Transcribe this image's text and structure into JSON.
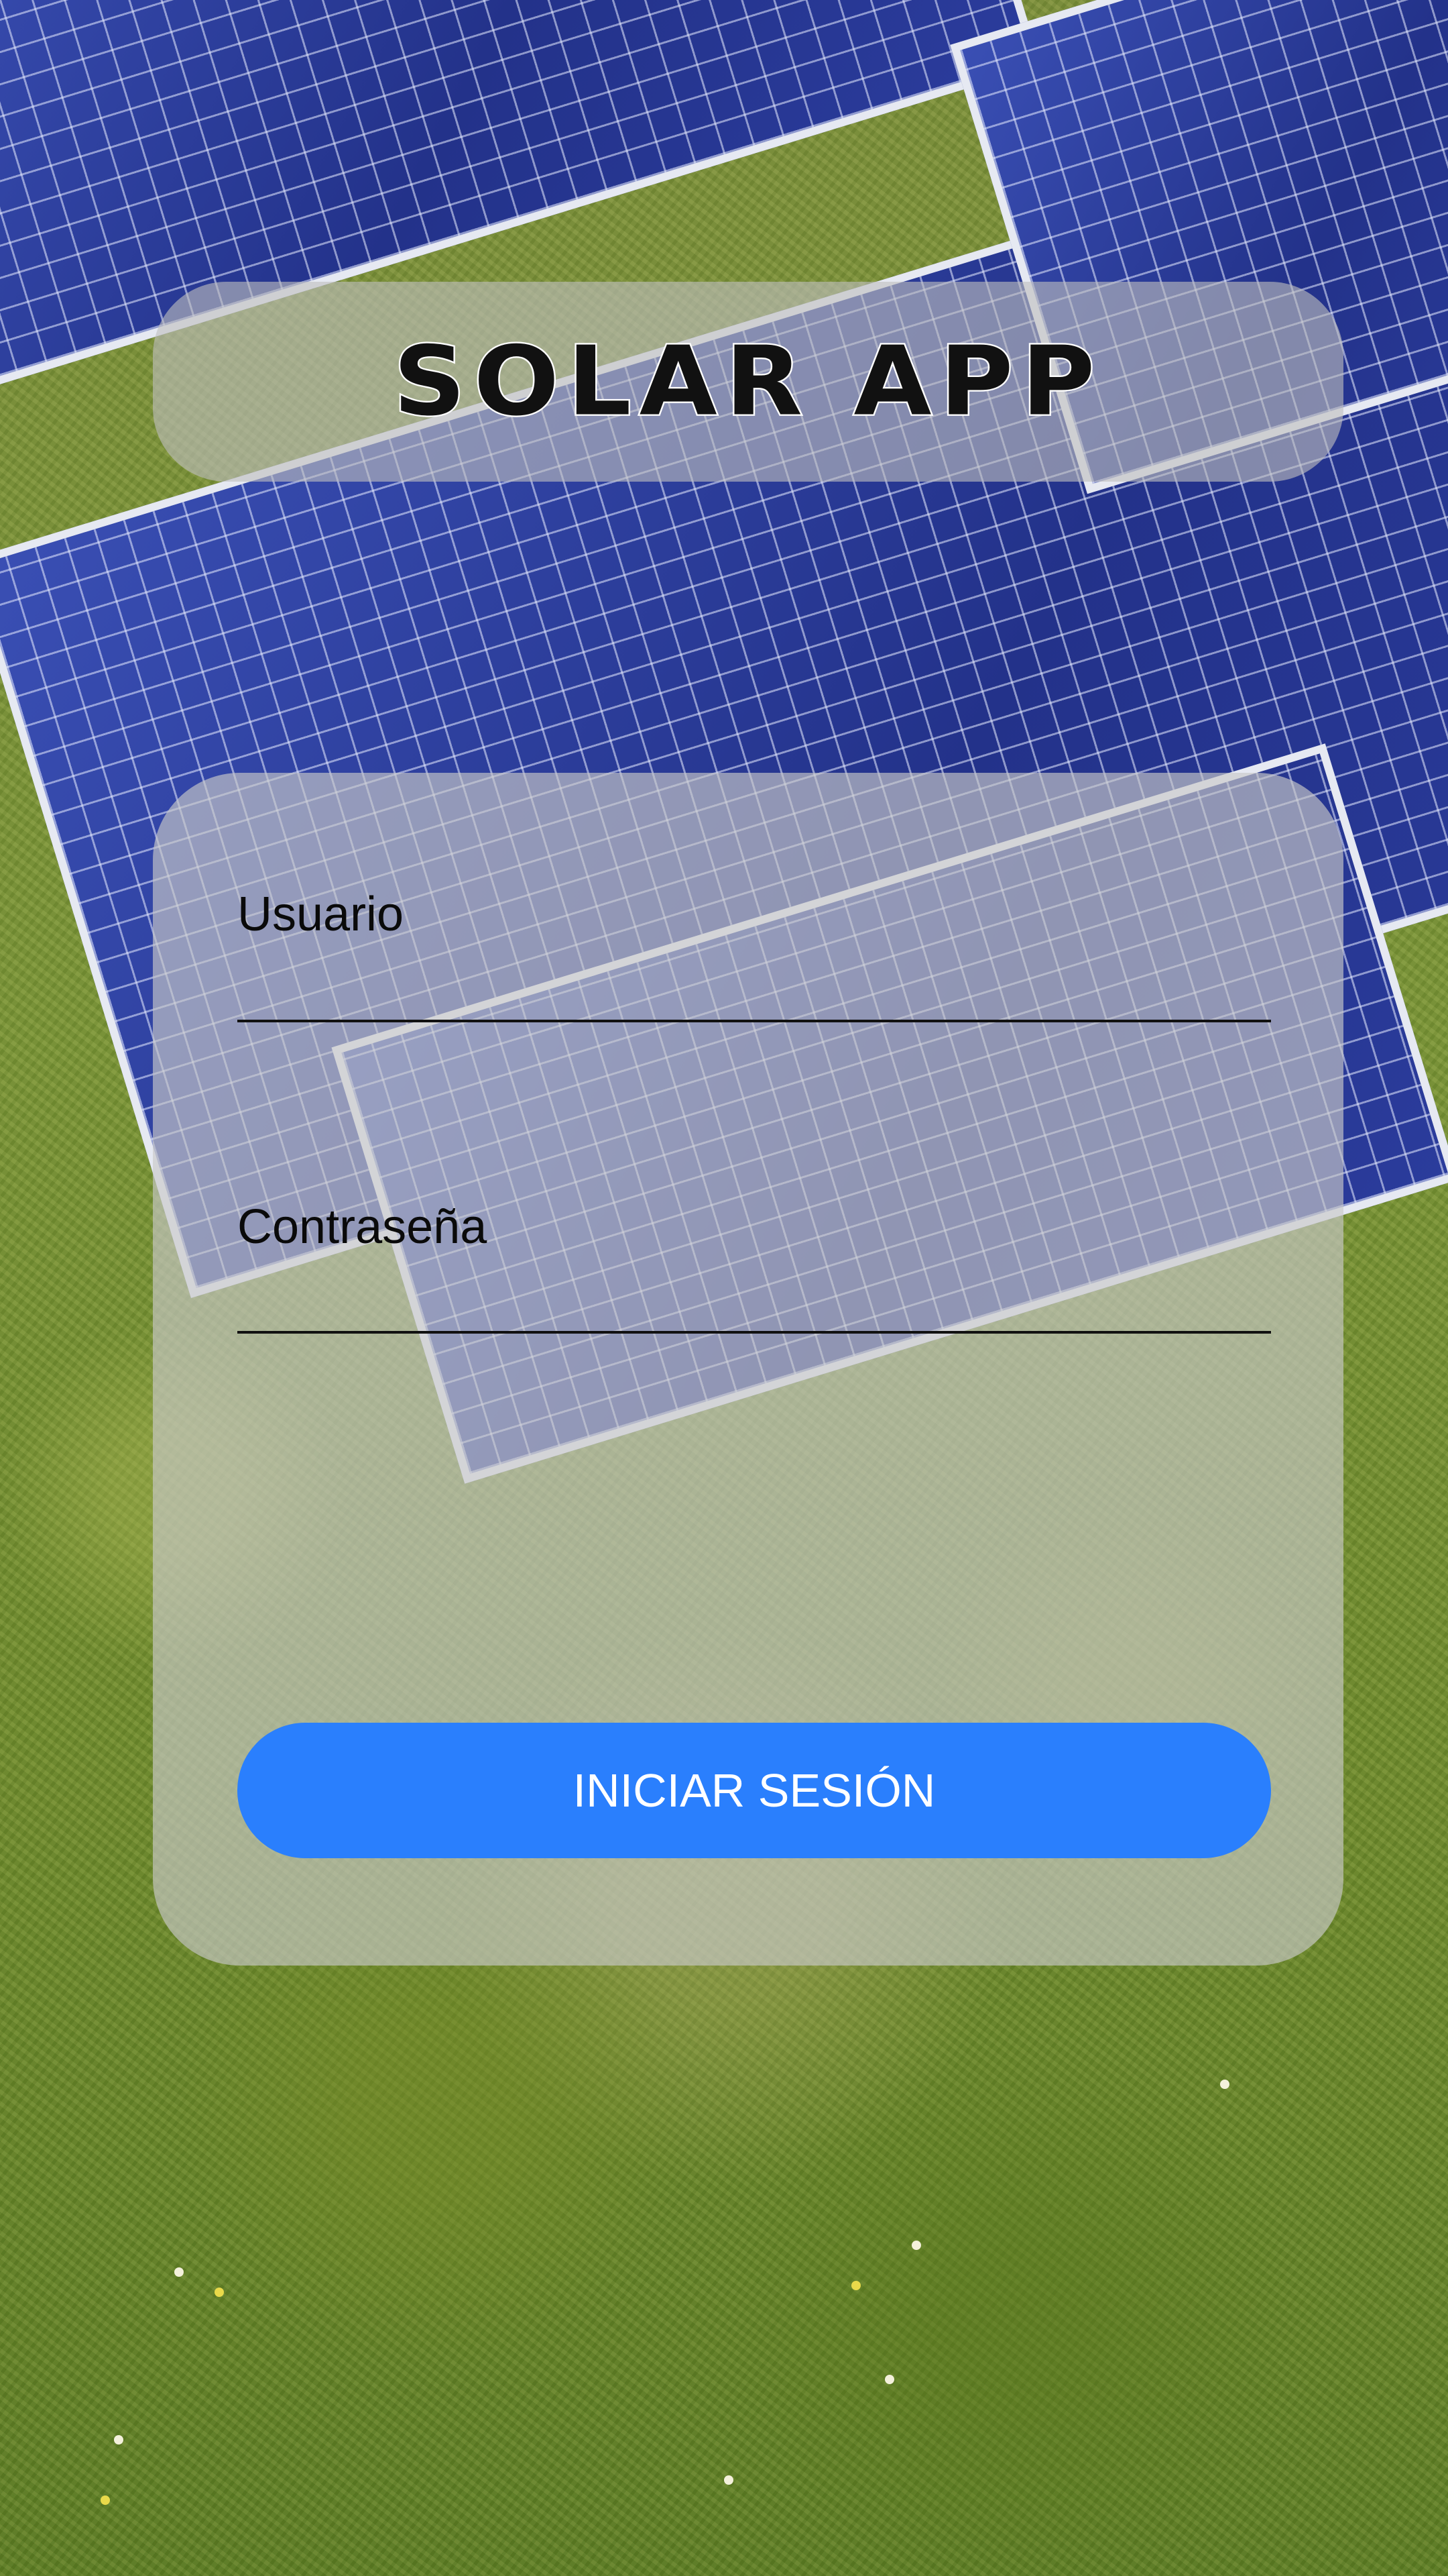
{
  "app": {
    "title": "SOLAR APP"
  },
  "login": {
    "username_label": "Usuario",
    "username_value": "",
    "password_label": "Contraseña",
    "password_value": "",
    "submit_label": "INICIAR SESIÓN"
  },
  "colors": {
    "primary_button": "#2a7ffd",
    "card_overlay": "#c8c8c8",
    "text": "#0a0a0a"
  }
}
